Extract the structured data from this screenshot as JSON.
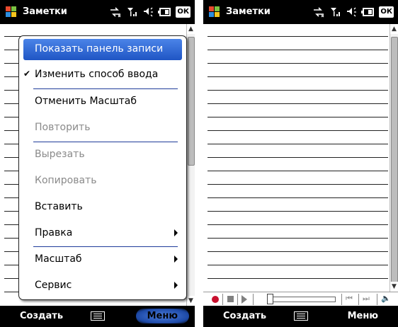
{
  "left_screen": {
    "title": "Заметки",
    "ok_label": "ОК",
    "softkeys": {
      "left": "Создать",
      "right": "Меню"
    },
    "context_menu": {
      "items": [
        {
          "label": "Показать панель записи",
          "state": "highlighted"
        },
        {
          "label": "Изменить способ ввода",
          "state": "checked"
        },
        {
          "label": "Отменить Масштаб",
          "state": "enabled"
        },
        {
          "label": "Повторить",
          "state": "disabled"
        },
        {
          "label": "Вырезать",
          "state": "disabled"
        },
        {
          "label": "Копировать",
          "state": "disabled"
        },
        {
          "label": "Вставить",
          "state": "enabled"
        },
        {
          "label": "Правка",
          "state": "submenu"
        },
        {
          "label": "Масштаб",
          "state": "submenu"
        },
        {
          "label": "Сервис",
          "state": "submenu"
        }
      ]
    }
  },
  "right_screen": {
    "title": "Заметки",
    "ok_label": "ОК",
    "softkeys": {
      "left": "Создать",
      "right": "Меню"
    },
    "recorder_bar": {
      "icons": [
        "record-icon",
        "stop-icon",
        "play-icon",
        "position-slider",
        "skip-back-icon",
        "skip-forward-icon",
        "volume-icon"
      ]
    }
  },
  "icons": {
    "titlebar": [
      "windows-logo-icon",
      "connectivity-icon",
      "signal-icon",
      "volume-icon",
      "battery-icon"
    ],
    "softkey_center": "keyboard-icon"
  },
  "colors": {
    "titlebar_bg": "#000000",
    "menu_highlight": "#2e64d2",
    "menu_separator": "#1f3c9a",
    "record_red": "#c8102e",
    "disabled_text": "#8a8a8a"
  }
}
